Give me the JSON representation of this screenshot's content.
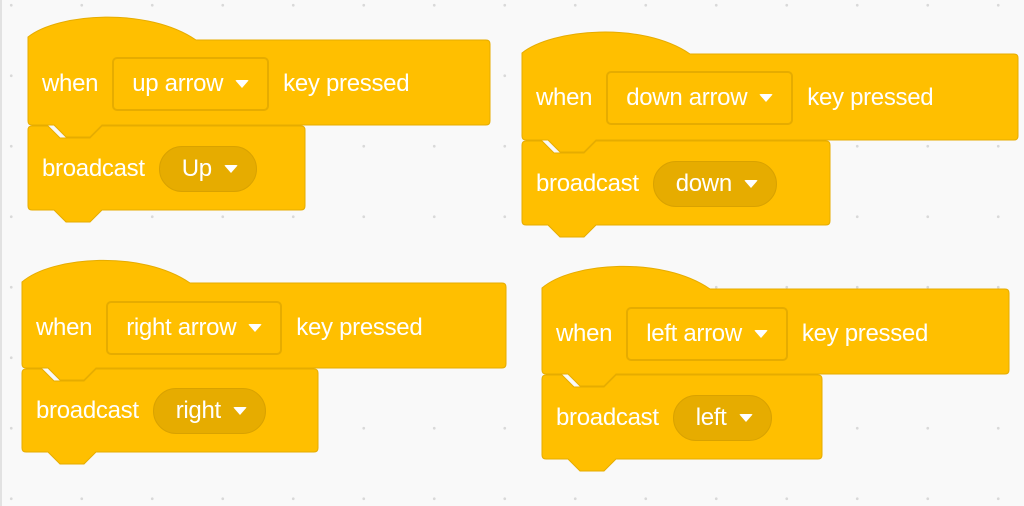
{
  "workspace": {
    "block_color": "#FFBF00",
    "block_dark": "#E6AC00",
    "background": "#F9F9F9"
  },
  "scripts": [
    {
      "event": {
        "prefix": "when",
        "key": "up arrow",
        "suffix": "key pressed"
      },
      "action": {
        "label": "broadcast",
        "message": "Up"
      }
    },
    {
      "event": {
        "prefix": "when",
        "key": "down arrow",
        "suffix": "key pressed"
      },
      "action": {
        "label": "broadcast",
        "message": "down"
      }
    },
    {
      "event": {
        "prefix": "when",
        "key": "right arrow",
        "suffix": "key pressed"
      },
      "action": {
        "label": "broadcast",
        "message": "right"
      }
    },
    {
      "event": {
        "prefix": "when",
        "key": "left arrow",
        "suffix": "key pressed"
      },
      "action": {
        "label": "broadcast",
        "message": "left"
      }
    }
  ]
}
